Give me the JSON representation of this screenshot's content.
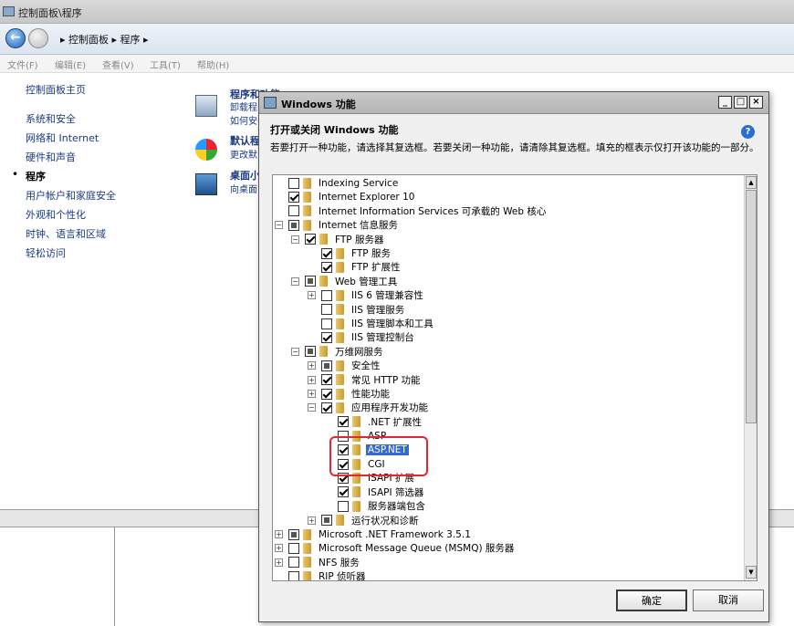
{
  "window": {
    "title": "控制面板\\程序"
  },
  "address": {
    "path": "▸ 控制面板 ▸ 程序 ▸"
  },
  "menu": [
    "文件(F)",
    "编辑(E)",
    "查看(V)",
    "工具(T)",
    "帮助(H)"
  ],
  "leftnav": {
    "items": [
      "控制面板主页",
      "系统和安全",
      "网络和 Internet",
      "硬件和声音",
      "程序",
      "用户帐户和家庭安全",
      "外观和个性化",
      "时钟、语言和区域",
      "轻松访问"
    ],
    "active_index": 4
  },
  "cp_items": [
    {
      "title": "程序和功能",
      "subs": [
        "卸载程",
        "如何安"
      ]
    },
    {
      "title": "默认程",
      "subs": [
        "更改默"
      ]
    },
    {
      "title": "桌面小",
      "subs": [
        "向桌面"
      ]
    }
  ],
  "dialog": {
    "title": "Windows 功能",
    "heading": "打开或关闭 Windows 功能",
    "description": "若要打开一种功能，请选择其复选框。若要关闭一种功能，请清除其复选框。填充的框表示仅打开该功能的一部分。",
    "ok_label": "确定",
    "cancel_label": "取消"
  },
  "tree": [
    {
      "label": "Indexing Service",
      "state": "unchecked",
      "level": 0,
      "expander": "none"
    },
    {
      "label": "Internet Explorer 10",
      "state": "checked",
      "level": 0,
      "expander": "none"
    },
    {
      "label": "Internet Information Services 可承载的 Web 核心",
      "state": "unchecked",
      "level": 0,
      "expander": "none"
    },
    {
      "label": "Internet 信息服务",
      "state": "partial",
      "level": 0,
      "expander": "minus"
    },
    {
      "label": "FTP 服务器",
      "state": "checked",
      "level": 1,
      "expander": "minus"
    },
    {
      "label": "FTP 服务",
      "state": "checked",
      "level": 2,
      "expander": "none"
    },
    {
      "label": "FTP 扩展性",
      "state": "checked",
      "level": 2,
      "expander": "none"
    },
    {
      "label": "Web 管理工具",
      "state": "partial",
      "level": 1,
      "expander": "minus"
    },
    {
      "label": "IIS 6 管理兼容性",
      "state": "unchecked",
      "level": 2,
      "expander": "plus"
    },
    {
      "label": "IIS 管理服务",
      "state": "unchecked",
      "level": 2,
      "expander": "none"
    },
    {
      "label": "IIS 管理脚本和工具",
      "state": "unchecked",
      "level": 2,
      "expander": "none"
    },
    {
      "label": "IIS 管理控制台",
      "state": "checked",
      "level": 2,
      "expander": "none"
    },
    {
      "label": "万维网服务",
      "state": "partial",
      "level": 1,
      "expander": "minus"
    },
    {
      "label": "安全性",
      "state": "partial",
      "level": 2,
      "expander": "plus"
    },
    {
      "label": "常见 HTTP 功能",
      "state": "checked",
      "level": 2,
      "expander": "plus"
    },
    {
      "label": "性能功能",
      "state": "checked",
      "level": 2,
      "expander": "plus"
    },
    {
      "label": "应用程序开发功能",
      "state": "checked",
      "level": 2,
      "expander": "minus"
    },
    {
      "label": ".NET 扩展性",
      "state": "checked",
      "level": 3,
      "expander": "none"
    },
    {
      "label": "ASP",
      "state": "unchecked",
      "level": 3,
      "expander": "none"
    },
    {
      "label": "ASP.NET",
      "state": "checked",
      "level": 3,
      "expander": "none",
      "selected": true
    },
    {
      "label": "CGI",
      "state": "checked",
      "level": 3,
      "expander": "none"
    },
    {
      "label": "ISAPI 扩展",
      "state": "checked",
      "level": 3,
      "expander": "none"
    },
    {
      "label": "ISAPI 筛选器",
      "state": "checked",
      "level": 3,
      "expander": "none"
    },
    {
      "label": "服务器端包含",
      "state": "unchecked",
      "level": 3,
      "expander": "none"
    },
    {
      "label": "运行状况和诊断",
      "state": "partial",
      "level": 2,
      "expander": "plus"
    },
    {
      "label": "Microsoft .NET Framework 3.5.1",
      "state": "partial",
      "level": 0,
      "expander": "plus"
    },
    {
      "label": "Microsoft Message Queue (MSMQ) 服务器",
      "state": "unchecked",
      "level": 0,
      "expander": "plus"
    },
    {
      "label": "NFS 服务",
      "state": "unchecked",
      "level": 0,
      "expander": "plus"
    },
    {
      "label": "RIP 侦听器",
      "state": "unchecked",
      "level": 0,
      "expander": "none"
    }
  ]
}
